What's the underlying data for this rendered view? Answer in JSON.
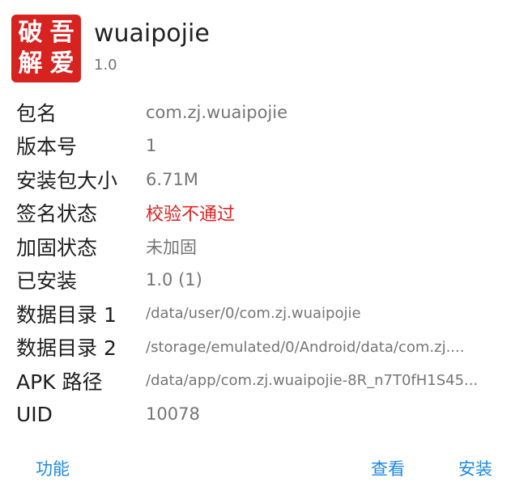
{
  "app": {
    "icon_chars": [
      "破",
      "吾",
      "解",
      "爱"
    ],
    "name": "wuaipojie",
    "version": "1.0"
  },
  "info_rows": [
    {
      "label": "包名",
      "value": "com.zj.wuaipojie"
    },
    {
      "label": "版本号",
      "value": "1"
    },
    {
      "label": "安装包大小",
      "value": "6.71M"
    },
    {
      "label": "签名状态",
      "value": "校验不通过"
    },
    {
      "label": "加固状态",
      "value": "未加固"
    },
    {
      "label": "已安装",
      "value": "1.0 (1)"
    },
    {
      "label": "数据目录 1",
      "value": "/data/user/0/com.zj.wuaipojie"
    },
    {
      "label": "数据目录 2",
      "value": "/storage/emulated/0/Android/data/com.zj...."
    },
    {
      "label": "APK 路径",
      "value": "/data/app/com.zj.wuaipojie-8R_n7T0fH1S45..."
    },
    {
      "label": "UID",
      "value": "10078"
    }
  ],
  "actions": {
    "function_label": "功能",
    "view_label": "查看",
    "install_label": "安装"
  },
  "colors": {
    "accent": "#1e88e5",
    "error": "#e02020",
    "icon_bg": "#d7231f"
  }
}
